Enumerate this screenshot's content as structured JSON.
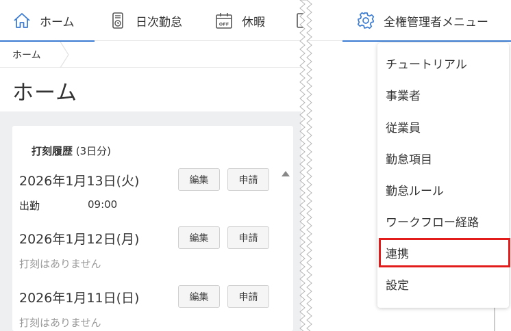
{
  "nav": {
    "home": "ホーム",
    "daily": "日次勤怠",
    "vacation": "休暇",
    "admin_menu": "全権管理者メニュー",
    "accent": "#3b7bd1",
    "icons": {
      "home": "home-icon",
      "daily": "timecard-icon",
      "vacation": "calendar-off-icon",
      "partial": "document-icon",
      "admin": "gear-icon"
    }
  },
  "breadcrumb": {
    "home": "ホーム"
  },
  "page": {
    "title": "ホーム"
  },
  "history": {
    "title_bold": "打刻履歴",
    "title_suffix": " (3日分)",
    "edit_label": "編集",
    "apply_label": "申請",
    "entries": [
      {
        "date": "2026年1月13日(火)",
        "type": "出勤",
        "time": "09:00"
      },
      {
        "date": "2026年1月12日(月)",
        "note": "打刻はありません"
      },
      {
        "date": "2026年1月11日(日)",
        "note": "打刻はありません"
      }
    ]
  },
  "admin_menu": {
    "items": [
      "チュートリアル",
      "事業者",
      "従業員",
      "勤怠項目",
      "勤怠ルール",
      "ワークフロー経路",
      "連携",
      "設定"
    ],
    "highlighted_index": 6,
    "highlight_color": "#e21b1b"
  }
}
